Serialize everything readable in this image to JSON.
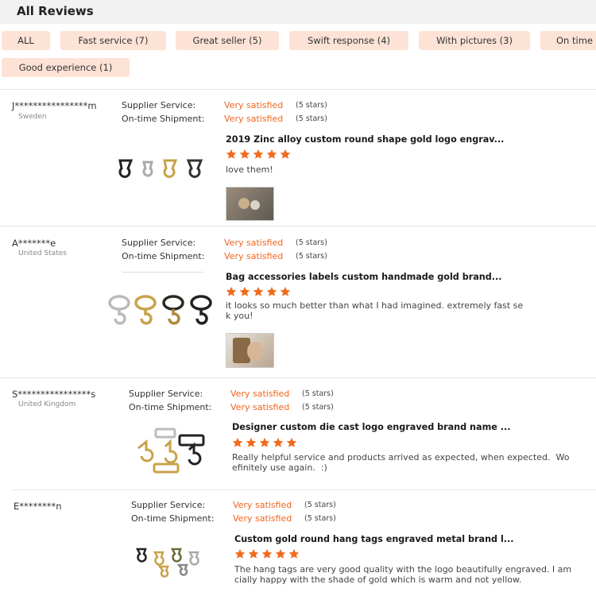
{
  "header": {
    "title": "All Reviews"
  },
  "filters": [
    {
      "label": "ALL"
    },
    {
      "label": "Fast service (7)"
    },
    {
      "label": "Great seller (5)"
    },
    {
      "label": "Swift response (4)"
    },
    {
      "label": "With pictures (3)"
    },
    {
      "label": "On time"
    },
    {
      "label": "Good experience (1)"
    }
  ],
  "colors": {
    "accent": "#f0651e",
    "chip_bg": "#fde3d6",
    "star": "#f26b1d"
  },
  "reviews": [
    {
      "user": "J****************m",
      "country": "Sweden",
      "supplier_label": "Supplier Service:",
      "supplier_value": "Very satisfied",
      "supplier_stars": "(5 stars)",
      "shipment_label": "On-time Shipment:",
      "shipment_value": "Very satisfied",
      "shipment_stars": "(5 stars)",
      "product": "2019 Zinc alloy custom round shape gold logo engrav...",
      "rating": 5,
      "comment": "love them!",
      "has_photo": true
    },
    {
      "user": "A*******e",
      "country": "United States",
      "supplier_label": "Supplier Service:",
      "supplier_value": "Very satisfied",
      "supplier_stars": "(5 stars)",
      "shipment_label": "On-time Shipment:",
      "shipment_value": "Very satisfied",
      "shipment_stars": "(5 stars)",
      "product": "Bag accessories labels custom handmade gold brand...",
      "rating": 5,
      "comment": "it looks so much better than what I had imagined. extremely fast se\nk you!",
      "has_photo": true
    },
    {
      "user": "S****************s",
      "country": "United Kingdom",
      "supplier_label": "Supplier Service:",
      "supplier_value": "Very satisfied",
      "supplier_stars": "(5 stars)",
      "shipment_label": "On-time Shipment:",
      "shipment_value": "Very satisfied",
      "shipment_stars": "(5 stars)",
      "product": "Designer custom die cast logo engraved brand name ...",
      "rating": 5,
      "comment": "Really helpful service and products arrived as expected, when expected.  Wo\nefinitely use again.  :)",
      "has_photo": false
    },
    {
      "user": "E********n",
      "country": "",
      "supplier_label": "Supplier Service:",
      "supplier_value": "Very satisfied",
      "supplier_stars": "(5 stars)",
      "shipment_label": "On-time Shipment:",
      "shipment_value": "Very satisfied",
      "shipment_stars": "(5 stars)",
      "product": "Custom gold round hang tags engraved metal brand l...",
      "rating": 5,
      "comment": "The hang tags are very good quality with the logo beautifully engraved. I am\ncially happy with the shade of gold which is warm and not yellow.",
      "has_photo": false
    }
  ]
}
